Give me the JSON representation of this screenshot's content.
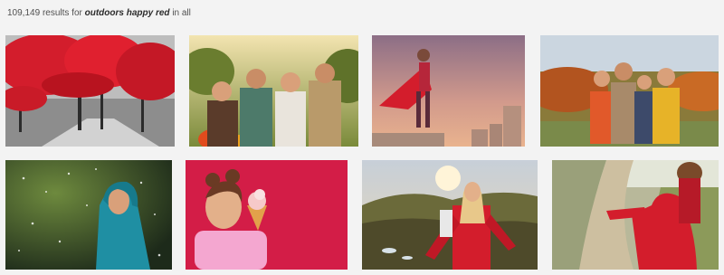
{
  "results": {
    "count": "109,149",
    "for_text": "results for",
    "query": "outdoors happy red",
    "scope_text": "in all"
  },
  "grid": {
    "images": [
      {
        "id": "img-1",
        "subject": "red-tree-park"
      },
      {
        "id": "img-2",
        "subject": "friends-wine-toast"
      },
      {
        "id": "img-3",
        "subject": "child-red-cape-sunset"
      },
      {
        "id": "img-4",
        "subject": "family-autumn-hug"
      },
      {
        "id": "img-5",
        "subject": "child-teal-hood-snow"
      },
      {
        "id": "img-6",
        "subject": "girl-ice-cream-red-wall"
      },
      {
        "id": "img-7",
        "subject": "woman-red-jacket-hills"
      },
      {
        "id": "img-8",
        "subject": "graduate-red-gown-path"
      }
    ]
  },
  "colors": {
    "background": "#f3f3f3",
    "accent_red": "#d31d2c",
    "text": "#505050"
  }
}
